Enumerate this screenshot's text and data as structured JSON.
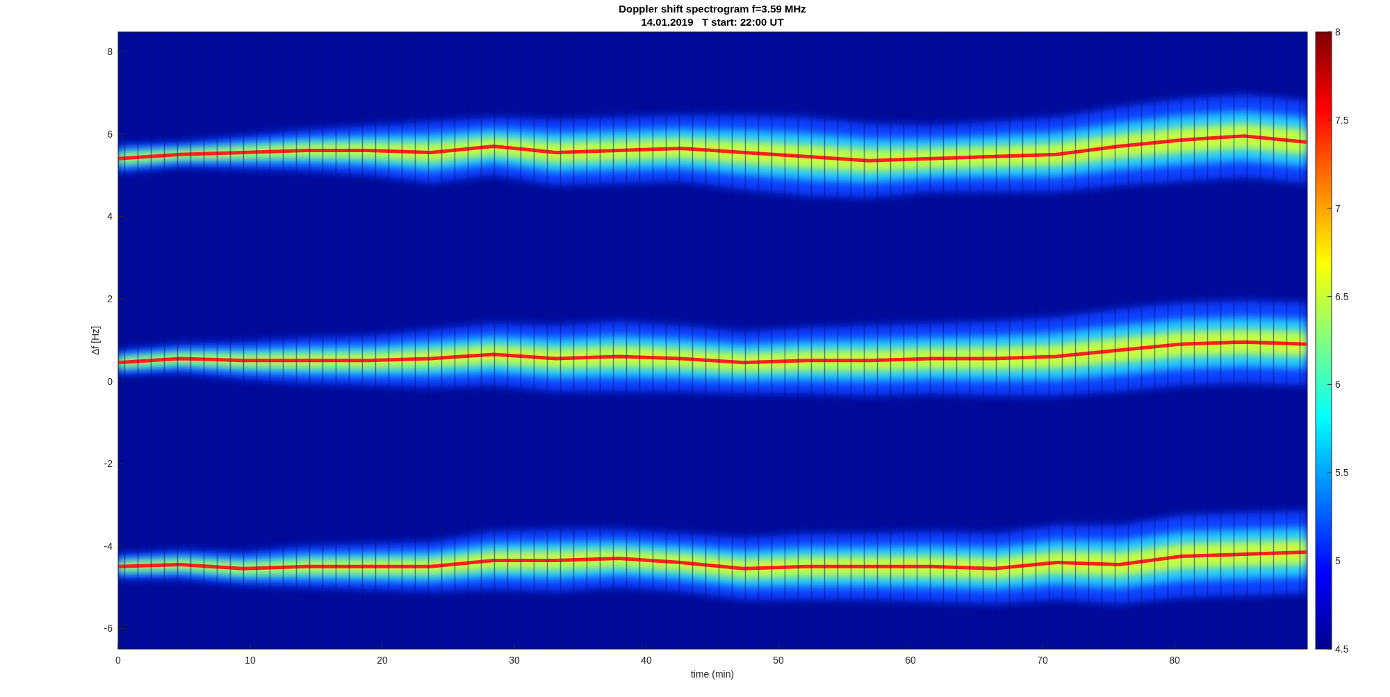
{
  "figure": {
    "title": "Doppler shift spectrogram f=3.59 MHz",
    "subtitle": "14.01.2019   T start: 22:00 UT",
    "xlabel": "time (min)",
    "ylabel": "Δf [Hz]",
    "xticks": [
      "0",
      "10",
      "20",
      "30",
      "40",
      "50",
      "60",
      "70",
      "80"
    ],
    "yticks": [
      "8",
      "6",
      "4",
      "2",
      "0",
      "-2",
      "-4",
      "-6"
    ],
    "colorbar_ticks": [
      "8",
      "7.5",
      "7",
      "6.5",
      "6",
      "5.5",
      "5",
      "4.5"
    ]
  }
}
